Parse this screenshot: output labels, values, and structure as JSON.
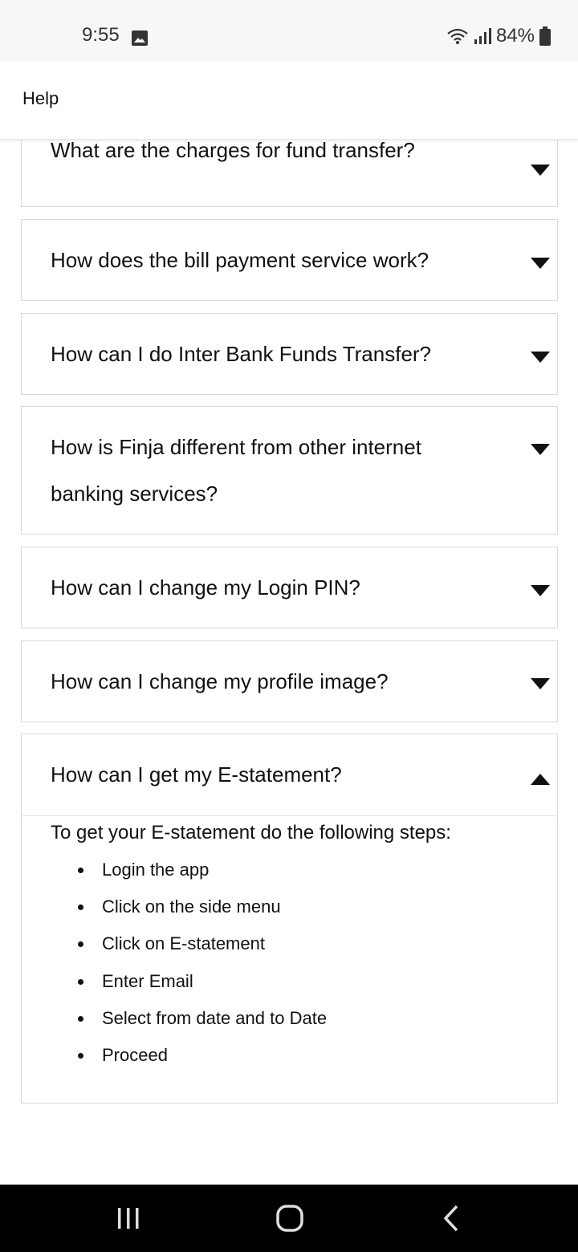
{
  "status_bar": {
    "time": "9:55",
    "battery": "84%",
    "icons": [
      "photo-icon",
      "wifi-icon",
      "signal-icon",
      "battery-icon"
    ]
  },
  "app_bar": {
    "title": "Help"
  },
  "faq": [
    {
      "question": "What are the charges for fund transfer?",
      "expanded": false
    },
    {
      "question": "How does the bill payment service work?",
      "expanded": false
    },
    {
      "question": "How can I do Inter Bank Funds Transfer?",
      "expanded": false
    },
    {
      "question": "How is Finja different from other internet banking services?",
      "expanded": false
    },
    {
      "question": "How can I change my Login PIN?",
      "expanded": false
    },
    {
      "question": "How can I change my profile image?",
      "expanded": false
    },
    {
      "question": "How can I get my E-statement?",
      "expanded": true
    }
  ],
  "answer": {
    "intro": "To get your E-statement do the following steps:",
    "steps": [
      "Login the app",
      "Click on the side menu",
      "Click on E-statement",
      "Enter Email",
      "Select from date and to Date",
      "Proceed"
    ]
  },
  "nav_bar": {
    "icons": [
      "recent-apps-icon",
      "home-icon",
      "back-icon"
    ]
  },
  "colors": {
    "border": "#d9d9d9",
    "status_bg": "#f7f7f7",
    "nav_bg": "#000000"
  }
}
